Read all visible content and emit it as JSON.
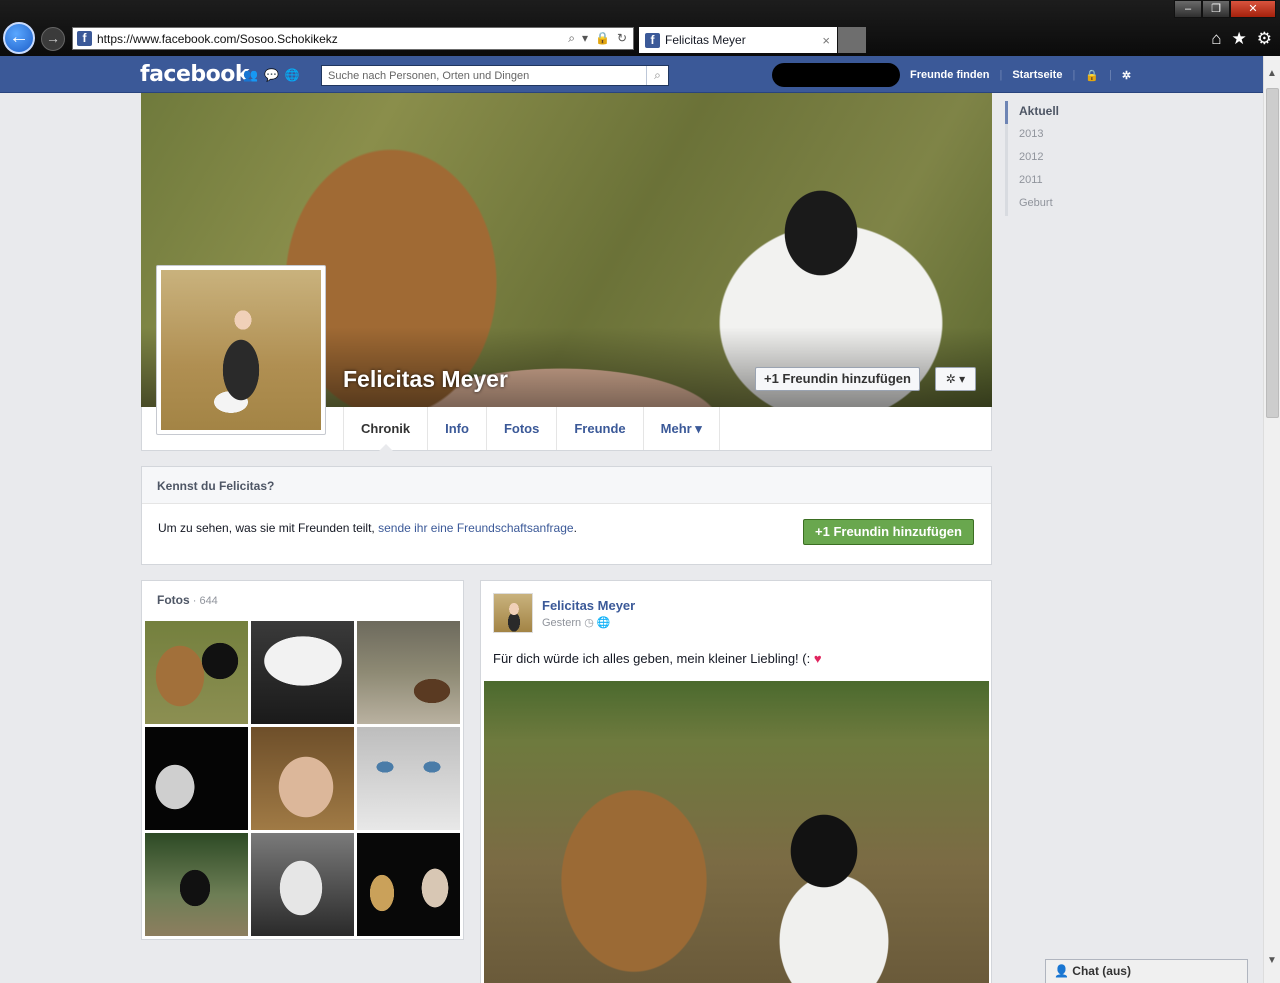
{
  "browser": {
    "url": "https://www.facebook.com/Sosoo.Schokikekz",
    "tab_title": "Felicitas Meyer",
    "tab_close": "×",
    "back_icon": "←",
    "forward_icon": "→"
  },
  "fb_header": {
    "logo": "facebook",
    "search_placeholder": "Suche nach Personen, Orten und Dingen",
    "links": [
      "Freunde finden",
      "Startseite"
    ]
  },
  "profile": {
    "name": "Felicitas Meyer",
    "add_friend_label": "+1 Freundin hinzufügen",
    "settings_label": "✲ ▾",
    "tabs": [
      "Chronik",
      "Info",
      "Fotos",
      "Freunde",
      "Mehr ▾"
    ]
  },
  "know_box": {
    "heading": "Kennst du Felicitas?",
    "text_prefix": "Um zu sehen, was sie mit Freunden teilt, ",
    "link_text": "sende ihr eine Freundschaftsanfrage",
    "text_suffix": ".",
    "button_label": "+1 Freundin hinzufügen"
  },
  "photos_box": {
    "title": "Fotos",
    "count": " · 644"
  },
  "post": {
    "author": "Felicitas Meyer",
    "time": "Gestern",
    "text": "Für dich würde ich alles geben, mein kleiner Liebling! (: "
  },
  "timeline_nav": [
    "Aktuell",
    "2013",
    "2012",
    "2011",
    "Geburt"
  ],
  "chat": {
    "label": "Chat (aus)"
  }
}
